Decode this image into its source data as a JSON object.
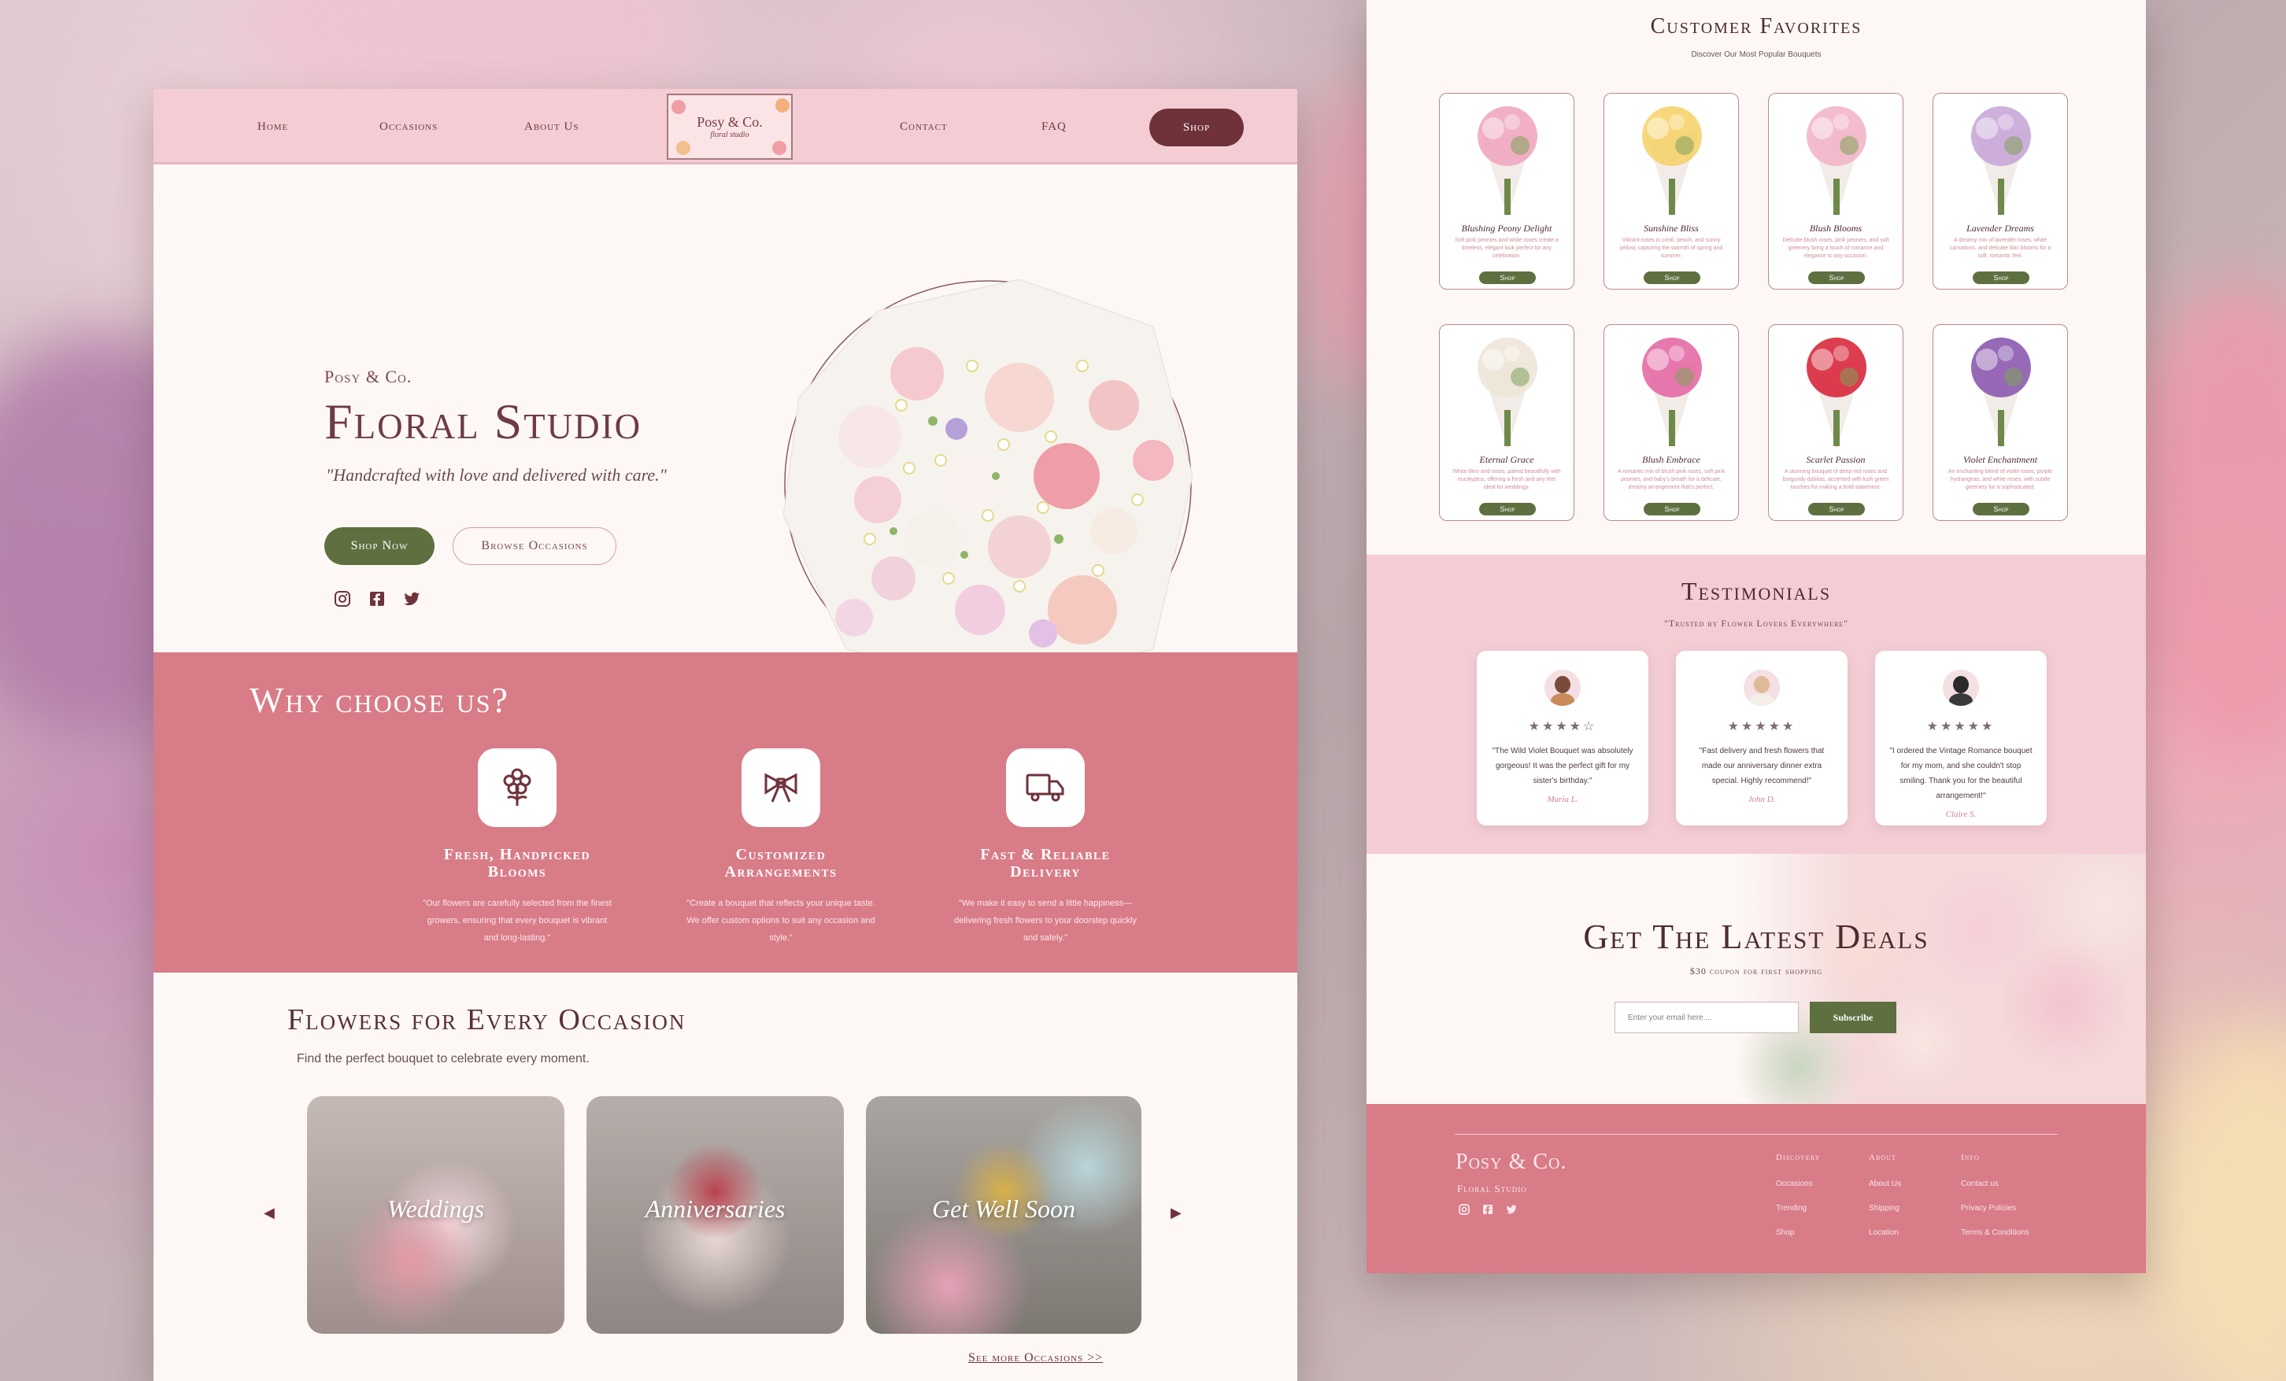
{
  "nav": {
    "home": "Home",
    "occasions": "Occasions",
    "about": "About Us",
    "contact": "Contact",
    "faq": "FAQ",
    "shop": "Shop",
    "logo_name": "Posy & Co.",
    "logo_sub": "floral studio"
  },
  "hero": {
    "brand": "Posy & Co.",
    "title": "Floral Studio",
    "tagline": "\"Handcrafted with love and delivered with care.\"",
    "shop_now": "Shop Now",
    "browse": "Browse Occasions"
  },
  "why": {
    "title": "Why choose us?",
    "features": [
      {
        "title": "Fresh, Handpicked Blooms",
        "text": "\"Our flowers are carefully selected from the finest growers, ensuring that every bouquet is vibrant and long-lasting.\"",
        "icon": "flower-icon"
      },
      {
        "title": "Customized Arrangements",
        "text": "\"Create a bouquet that reflects your unique taste. We offer custom options to suit any occasion and style.\"",
        "icon": "bow-icon"
      },
      {
        "title": "Fast & Reliable Delivery",
        "text": "\"We make it easy to send a little happiness—delivering fresh flowers to your doorstep quickly and safely.\"",
        "icon": "truck-icon"
      }
    ]
  },
  "occasions": {
    "title": "Flowers for Every Occasion",
    "subtitle": "Find the perfect bouquet to celebrate every moment.",
    "cards": [
      "Weddings",
      "Anniversaries",
      "Get Well Soon"
    ],
    "more": "See more Occasions >>"
  },
  "favorites": {
    "title": "Customer Favorites",
    "subtitle": "Discover Our Most Popular Bouquets",
    "shop_label": "Shop",
    "products": [
      {
        "name": "Blushing Peony Delight",
        "desc": "Soft pink peonies and white roses create a timeless, elegant look perfect for any celebration.",
        "color": "#f0a7c0"
      },
      {
        "name": "Sunshine Bliss",
        "desc": "Vibrant roses in coral, peach, and sunny yellow, capturing the warmth of spring and summer.",
        "color": "#f6d36b"
      },
      {
        "name": "Blush Blooms",
        "desc": "Delicate blush roses, pink peonies, and soft greenery bring a touch of romance and elegance to any occasion.",
        "color": "#f2b6c8"
      },
      {
        "name": "Lavender Dreams",
        "desc": "A dreamy mix of lavender roses, white carnations, and delicate lilac blooms for a soft, romantic feel.",
        "color": "#c9a7d8"
      },
      {
        "name": "Eternal Grace",
        "desc": "White lilies and roses, paired beautifully with eucalyptus, offering a fresh and airy feel ideal for weddings.",
        "color": "#eee6d8"
      },
      {
        "name": "Blush Embrace",
        "desc": "A romantic mix of blush pink roses, soft pink peonies, and baby's breath for a delicate, dreamy arrangement that's perfect.",
        "color": "#e46aa6"
      },
      {
        "name": "Scarlet Passion",
        "desc": "A stunning bouquet of deep red roses and burgundy dahlias, accented with lush green touches for making a bold statement.",
        "color": "#d8283c"
      },
      {
        "name": "Violet Enchantment",
        "desc": "An enchanting blend of violet roses, purple hydrangeas, and white roses, with subtle greenery for a sophisticated.",
        "color": "#8c5ab0"
      }
    ]
  },
  "testimonials": {
    "title": "Testimonials",
    "subtitle": "\"Trusted by Flower Lovers Everywhere\"",
    "items": [
      {
        "stars": "★★★★☆",
        "text": "\"The Wild Violet Bouquet was absolutely gorgeous! It was the perfect gift for my sister's birthday.\"",
        "name": "Maria L."
      },
      {
        "stars": "★★★★★",
        "text": "\"Fast delivery and fresh flowers that made our anniversary dinner extra special. Highly recommend!\"",
        "name": "John D."
      },
      {
        "stars": "★★★★★",
        "text": "\"I ordered the Vintage Romance bouquet for my mom, and she couldn't stop smiling. Thank you for the beautiful arrangement!\"",
        "name": "Claire S."
      }
    ]
  },
  "deals": {
    "title": "Get The Latest Deals",
    "subtitle": "$30 coupon for first shopping",
    "placeholder": "Enter your email here....",
    "button": "Subscribe"
  },
  "footer": {
    "brand": "Posy & Co.",
    "sub": "Floral Studio",
    "cols": [
      {
        "head": "Discovery",
        "links": [
          "Occasions",
          "Trending",
          "Shop"
        ]
      },
      {
        "head": "About",
        "links": [
          "About Us",
          "Shipping",
          "Location"
        ]
      },
      {
        "head": "Info",
        "links": [
          "Contact us",
          "Privacy Policies",
          "Terms & Conditions"
        ]
      }
    ]
  },
  "colors": {
    "pink": "#f4ccd4",
    "rose": "#d87c88",
    "green": "#5e7040",
    "wine": "#6f323b",
    "cream": "#fdf8f5"
  }
}
